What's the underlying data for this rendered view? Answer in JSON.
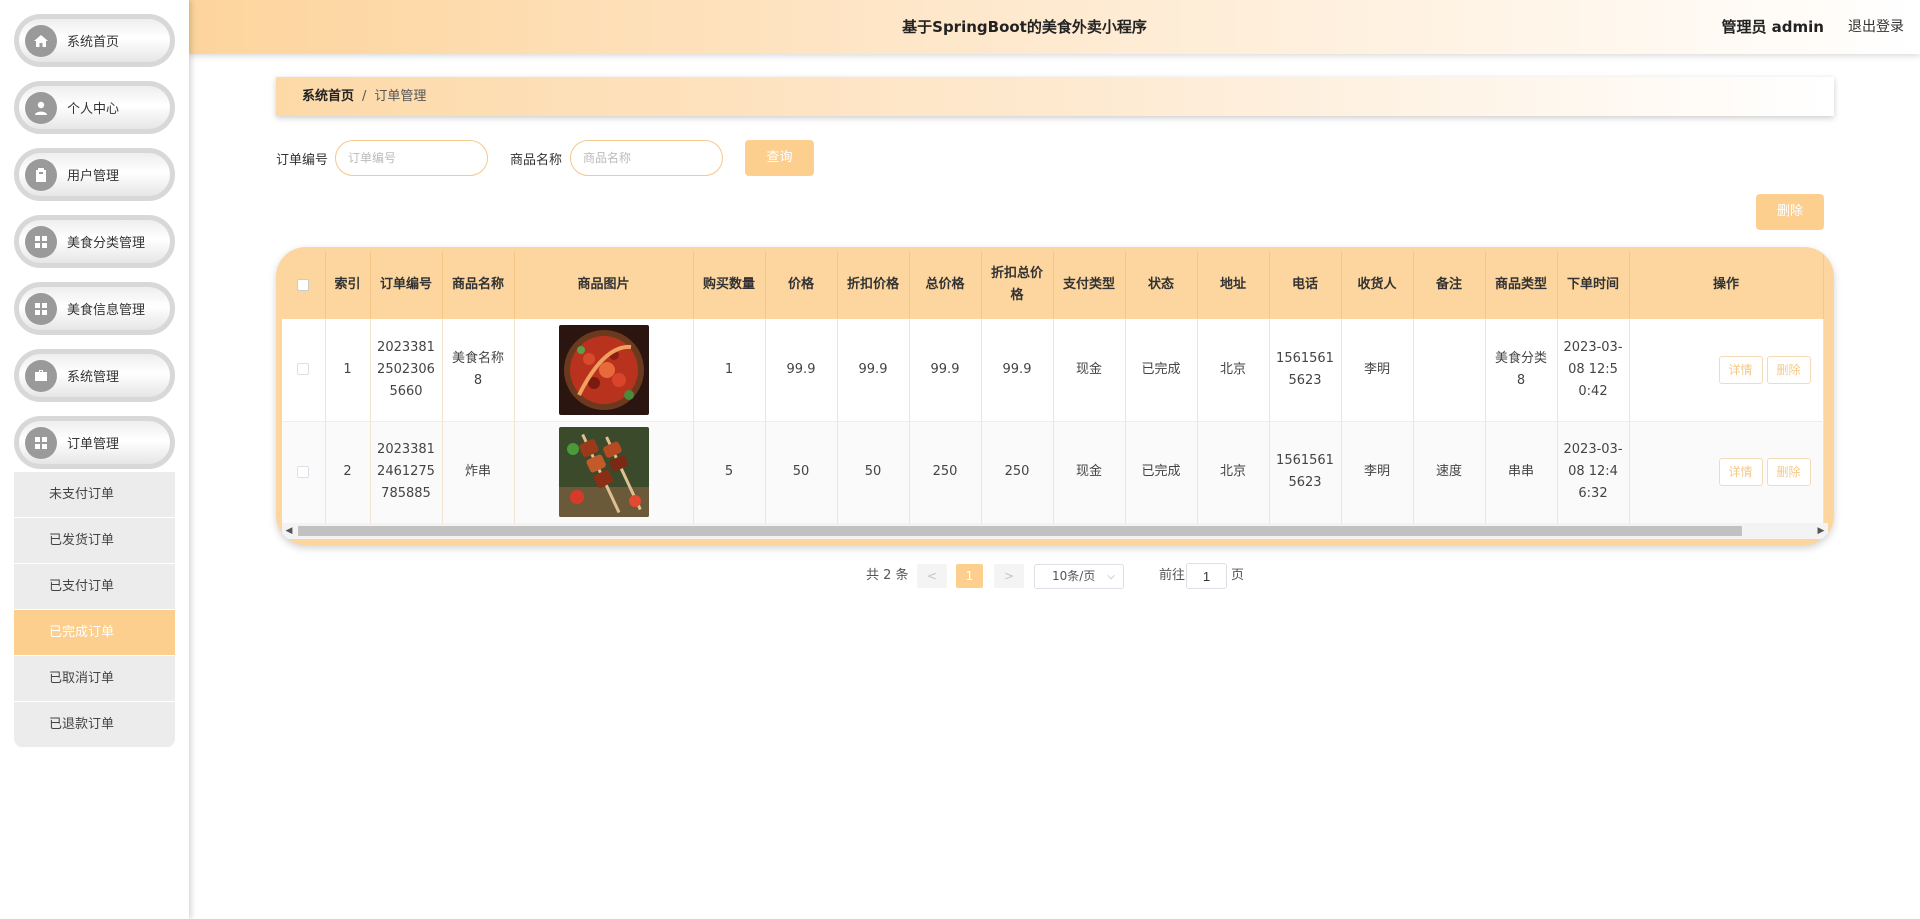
{
  "sidebar": {
    "menu": [
      {
        "label": "系统首页",
        "icon": "home-icon"
      },
      {
        "label": "个人中心",
        "icon": "user-icon"
      },
      {
        "label": "用户管理",
        "icon": "clipboard-icon"
      },
      {
        "label": "美食分类管理",
        "icon": "grid-icon"
      },
      {
        "label": "美食信息管理",
        "icon": "grid-icon"
      },
      {
        "label": "系统管理",
        "icon": "briefcase-icon"
      },
      {
        "label": "订单管理",
        "icon": "grid-icon"
      }
    ],
    "submenu": [
      {
        "label": "未支付订单"
      },
      {
        "label": "已发货订单"
      },
      {
        "label": "已支付订单"
      },
      {
        "label": "已完成订单",
        "active": true
      },
      {
        "label": "已取消订单"
      },
      {
        "label": "已退款订单"
      }
    ]
  },
  "header": {
    "title": "基于SpringBoot的美食外卖小程序",
    "user": "管理员 admin",
    "logout": "退出登录"
  },
  "breadcrumb": {
    "home": "系统首页",
    "separator": "/",
    "current": "订单管理"
  },
  "search": {
    "order_no_label": "订单编号",
    "order_no_placeholder": "订单编号",
    "order_no_value": "",
    "product_label": "商品名称",
    "product_placeholder": "商品名称",
    "product_value": "",
    "query_button": "查询"
  },
  "actions": {
    "delete_button": "删除"
  },
  "table": {
    "columns": [
      "索引",
      "订单编号",
      "商品名称",
      "商品图片",
      "购买数量",
      "价格",
      "折扣价格",
      "总价格",
      "折扣总价格",
      "支付类型",
      "状态",
      "地址",
      "电话",
      "收货人",
      "备注",
      "商品类型",
      "下单时间",
      "操作"
    ],
    "rows": [
      {
        "index": "1",
        "order_no": "20233812502306 5660",
        "product_name": "美食名称8",
        "image": "chili-dish",
        "quantity": "1",
        "price": "99.9",
        "discount_price": "99.9",
        "total_price": "99.9",
        "discount_total": "99.9",
        "pay_type": "现金",
        "status": "已完成",
        "address": "北京",
        "phone": "15615615623",
        "receiver": "李明",
        "remark": "",
        "product_type": "美食分类8",
        "order_time": "2023-03-08 12:50:42"
      },
      {
        "index": "2",
        "order_no": "20233812461275785885",
        "product_name": "炸串",
        "image": "skewers",
        "quantity": "5",
        "price": "50",
        "discount_price": "50",
        "total_price": "250",
        "discount_total": "250",
        "pay_type": "现金",
        "status": "已完成",
        "address": "北京",
        "phone": "15615615623",
        "receiver": "李明",
        "remark": "速度",
        "product_type": "串串",
        "order_time": "2023-03-08 12:46:32"
      }
    ],
    "detail_button": "详情",
    "delete_button": "删除"
  },
  "pagination": {
    "total": "共 2 条",
    "prev": "<",
    "current": "1",
    "next": ">",
    "page_size": "10条/页",
    "goto_label": "前往",
    "goto_value": "1",
    "goto_unit": "页"
  },
  "colors": {
    "accent": "#fccf8f",
    "header_gradient_start": "#fdd49c",
    "table_header": "#fcd59f"
  }
}
